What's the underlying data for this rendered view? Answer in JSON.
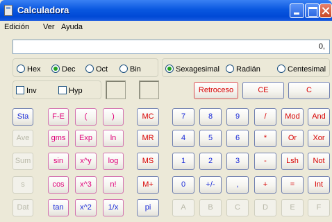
{
  "window": {
    "title": "Calculadora"
  },
  "menu": [
    "Edición",
    "Ver",
    "Ayuda"
  ],
  "display": {
    "value": "0,"
  },
  "radix": [
    "Hex",
    "Dec",
    "Oct",
    "Bin"
  ],
  "radix_selected": "Dec",
  "angle": [
    "Sexagesimal",
    "Radián",
    "Centesimal"
  ],
  "angle_selected": "Sexagesimal",
  "checks": [
    "Inv",
    "Hyp"
  ],
  "edit_buttons": [
    "Retroceso",
    "CE",
    "C"
  ],
  "stat_buttons": [
    "Sta",
    "Ave",
    "Sum",
    "s",
    "Dat"
  ],
  "sci_rows": [
    [
      "F-E",
      "(",
      ")"
    ],
    [
      "gms",
      "Exp",
      "ln"
    ],
    [
      "sin",
      "x^y",
      "log"
    ],
    [
      "cos",
      "x^3",
      "n!"
    ],
    [
      "tan",
      "x^2",
      "1/x"
    ]
  ],
  "memory_buttons": [
    "MC",
    "MR",
    "MS",
    "M+",
    "pi"
  ],
  "keypad_rows": [
    [
      "7",
      "8",
      "9",
      "/",
      "Mod",
      "And"
    ],
    [
      "4",
      "5",
      "6",
      "*",
      "Or",
      "Xor"
    ],
    [
      "1",
      "2",
      "3",
      "-",
      "Lsh",
      "Not"
    ],
    [
      "0",
      "+/-",
      ",",
      "+",
      "=",
      "Int"
    ],
    [
      "A",
      "B",
      "C",
      "D",
      "E",
      "F"
    ]
  ]
}
